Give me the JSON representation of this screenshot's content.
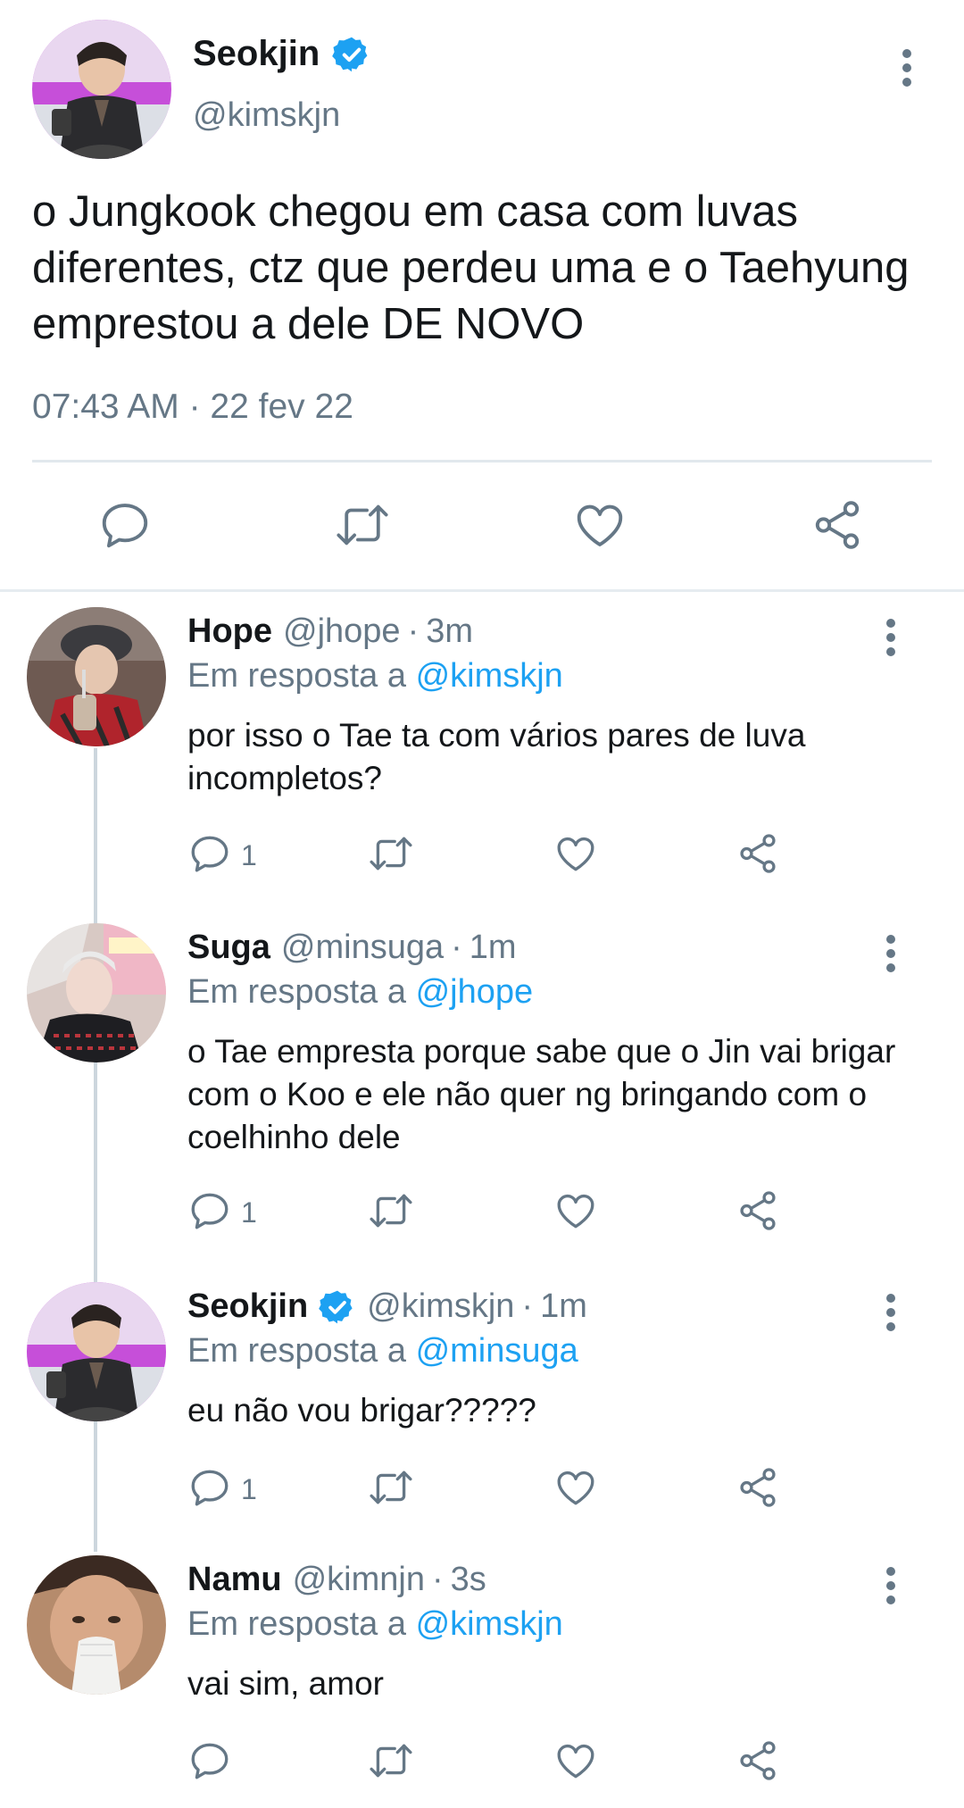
{
  "main": {
    "name": "Seokjin",
    "handle": "@kimskjn",
    "text": "o Jungkook chegou em casa com luvas diferentes, ctz que perdeu uma e o Taehyung emprestou a dele DE NOVO",
    "timestamp": "07:43 AM · 22 fev 22",
    "verified": true,
    "icons": [
      "reply-icon",
      "retweet-icon",
      "like-icon",
      "share-icon"
    ]
  },
  "replies": [
    {
      "name": "Hope",
      "handle": "@jhope",
      "sep": "·",
      "time": "3m",
      "reply_prefix": "Em resposta a",
      "reply_to": "@kimskjn",
      "text": "por isso o Tae ta com vários pares de luva incompletos?",
      "reply_count": "1",
      "verified": false
    },
    {
      "name": "Suga",
      "handle": "@minsuga",
      "sep": "·",
      "time": "1m",
      "reply_prefix": "Em resposta a",
      "reply_to": "@jhope",
      "text": "o Tae empresta porque sabe que o Jin vai brigar com o Koo e ele não quer ng bringando com o coelhinho dele",
      "reply_count": "1",
      "verified": false
    },
    {
      "name": "Seokjin",
      "handle": "@kimskjn",
      "sep": "·",
      "time": "1m",
      "reply_prefix": "Em resposta a",
      "reply_to": "@minsuga",
      "text": "eu não vou brigar?????",
      "reply_count": "1",
      "verified": true
    },
    {
      "name": "Namu",
      "handle": "@kimnjn",
      "sep": "·",
      "time": "3s",
      "reply_prefix": "Em resposta a",
      "reply_to": "@kimskjn",
      "text": "vai sim, amor",
      "reply_count": "",
      "verified": false
    }
  ],
  "colors": {
    "accent": "#1da1f2",
    "text": "#14171a",
    "muted": "#657786",
    "divider": "#e1e8ed"
  }
}
